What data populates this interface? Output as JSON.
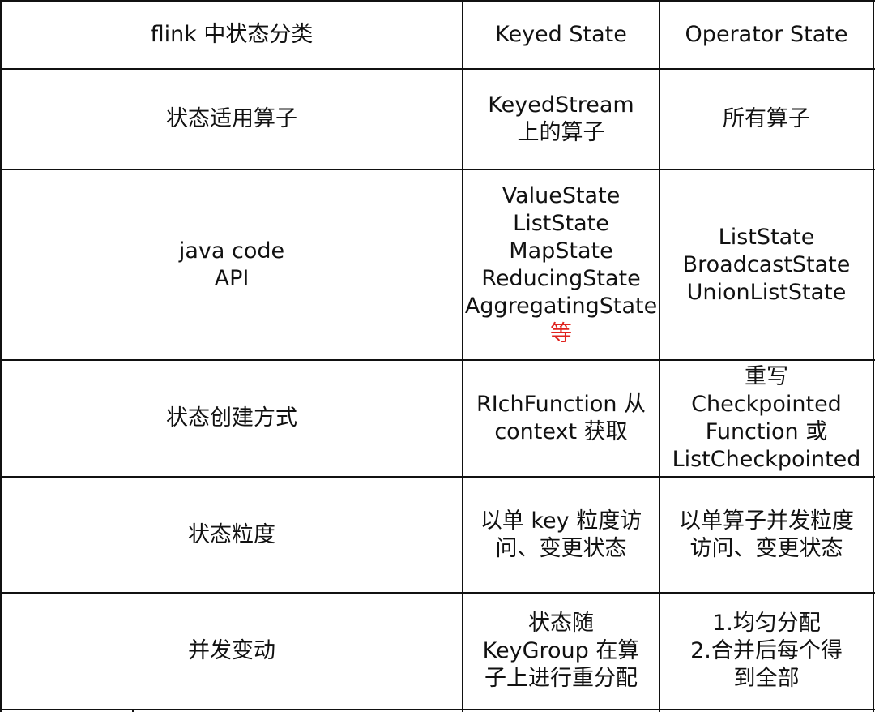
{
  "table": {
    "header": {
      "col1": "flink 中状态分类",
      "col2": "Keyed State",
      "col3": "Operator State"
    },
    "rows": [
      {
        "label": [
          "状态适用算子"
        ],
        "keyed": [
          "KeyedStream",
          "上的算子"
        ],
        "operator": [
          "所有算子"
        ]
      },
      {
        "label": [
          "java code",
          "API"
        ],
        "keyed": [
          "ValueState",
          "ListState",
          "MapState",
          "ReducingState",
          "AggregatingState",
          "等"
        ],
        "operator": [
          "ListState",
          "BroadcastState",
          "UnionListState"
        ]
      },
      {
        "label": [
          "状态创建方式"
        ],
        "keyed": [
          "RIchFunction 从",
          "context 获取"
        ],
        "operator": [
          "重写",
          "Checkpointed",
          "Function 或",
          "ListCheckpointed"
        ]
      },
      {
        "label": [
          "状态粒度"
        ],
        "keyed": [
          "以单 key 粒度访",
          "问、变更状态"
        ],
        "operator": [
          "以单算子并发粒度",
          "访问、变更状态"
        ]
      },
      {
        "label": [
          "并发变动"
        ],
        "keyed": [
          "状态随",
          "KeyGroup 在算",
          "子上进行重分配"
        ],
        "operator": [
          "1.均匀分配",
          "2.合并后每个得",
          "到全部"
        ]
      }
    ],
    "colors": {
      "border": "#111111",
      "text": "#111111",
      "highlight": "#e0221e"
    }
  }
}
